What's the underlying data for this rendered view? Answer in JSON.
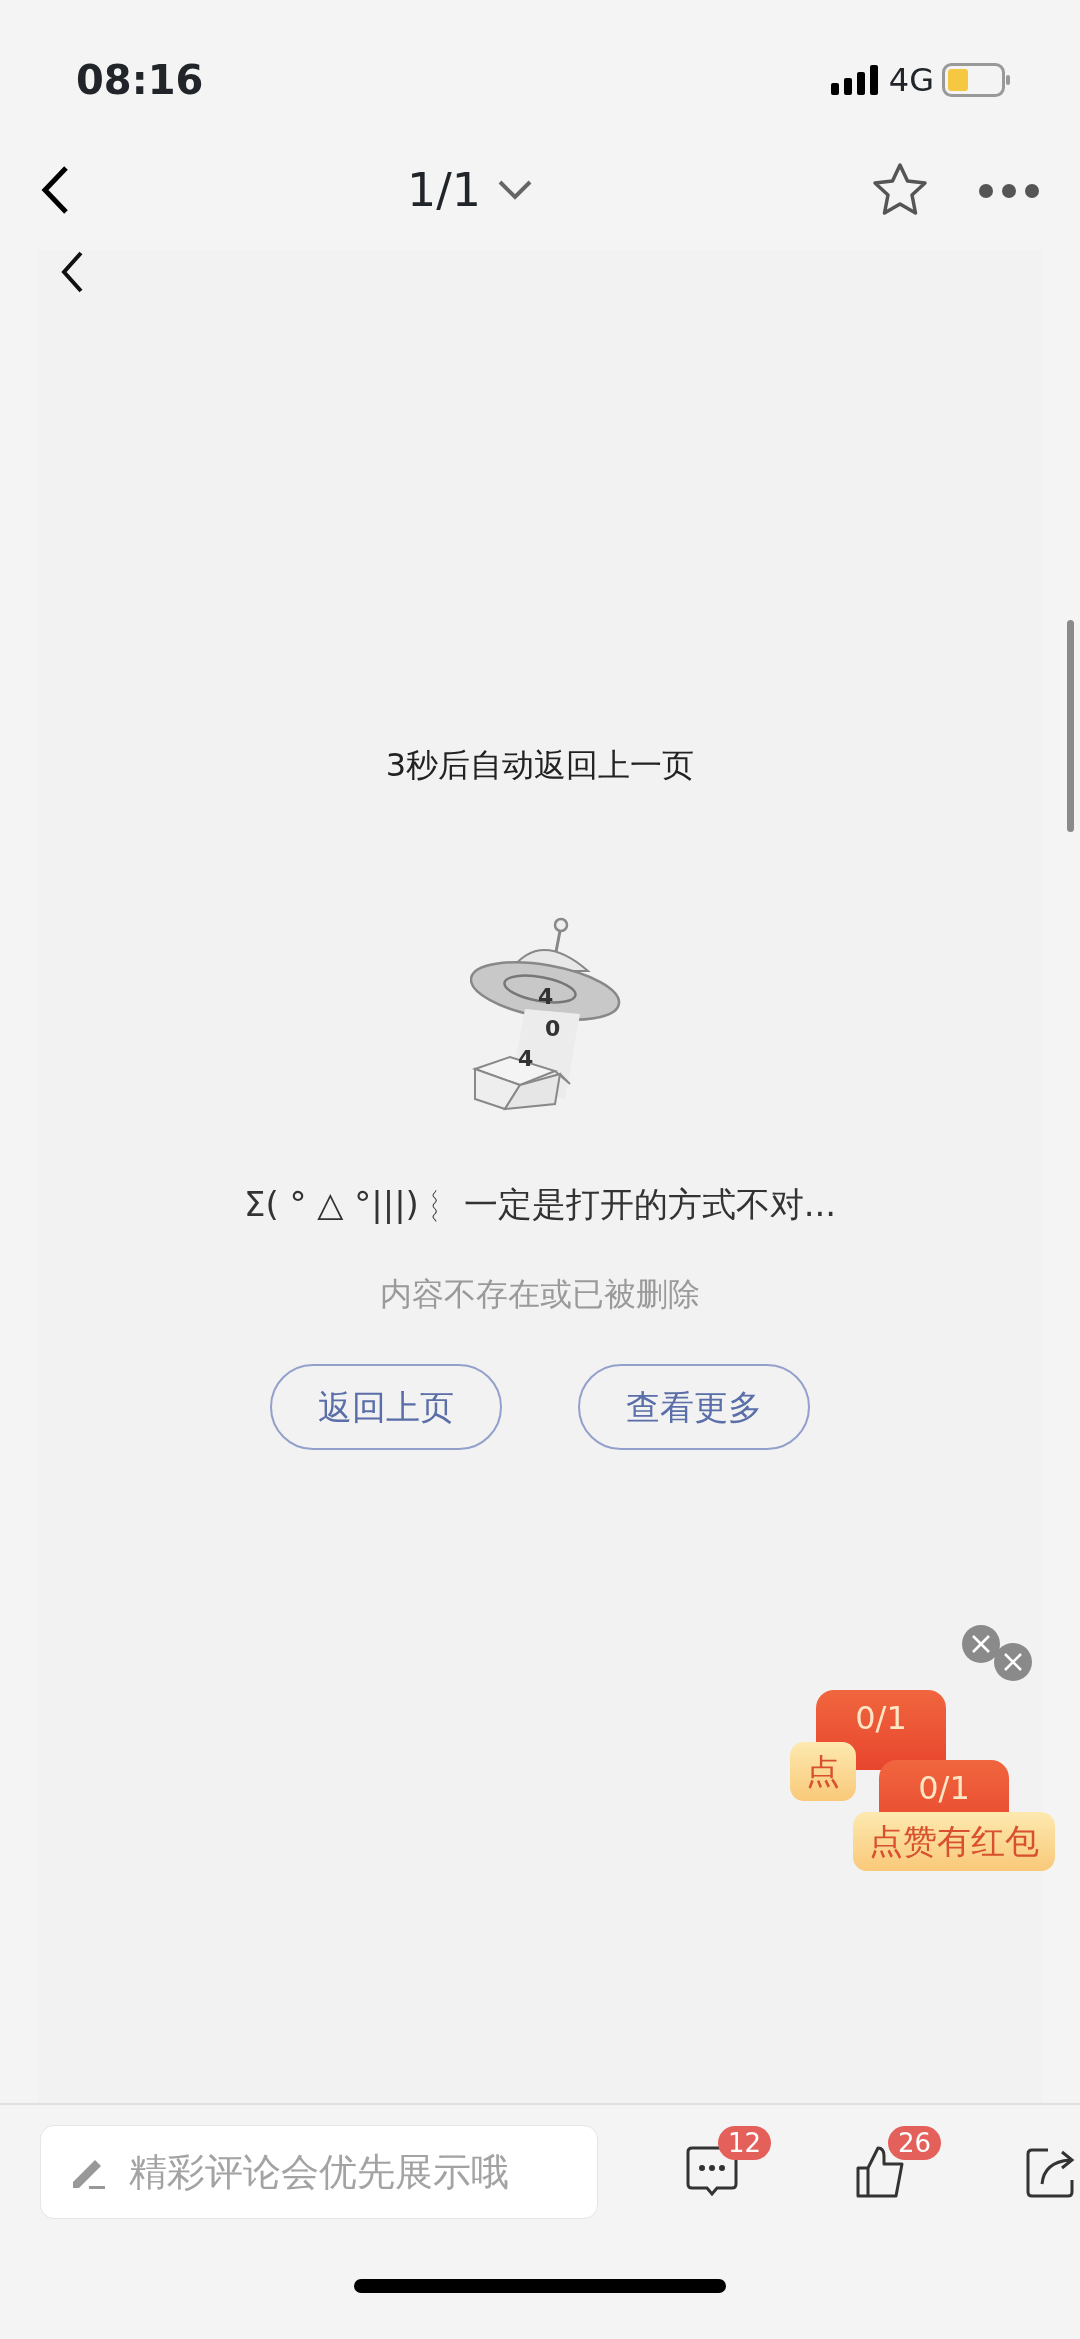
{
  "status_bar": {
    "time": "08:16",
    "network": "4G"
  },
  "nav_bar": {
    "title": "1/1"
  },
  "page": {
    "countdown": "3秒后自动返回上一页",
    "illustration_digits": [
      "4",
      "0",
      "4"
    ],
    "message": "Σ( ° △ °|||)︴ 一定是打开的方式不对...",
    "hint": "内容不存在或已被删除",
    "buttons": [
      "返回上页",
      "查看更多"
    ]
  },
  "promos": [
    {
      "count": "0/1",
      "label": "点"
    },
    {
      "count": "0/1",
      "label": "点赞有红包"
    }
  ],
  "bottom_bar": {
    "comment": {
      "placeholder": "精彩评论会优先展示哦"
    },
    "actions": [
      {
        "kind": "comment",
        "badge": "12"
      },
      {
        "kind": "like",
        "badge": "26"
      },
      {
        "kind": "share"
      }
    ]
  }
}
